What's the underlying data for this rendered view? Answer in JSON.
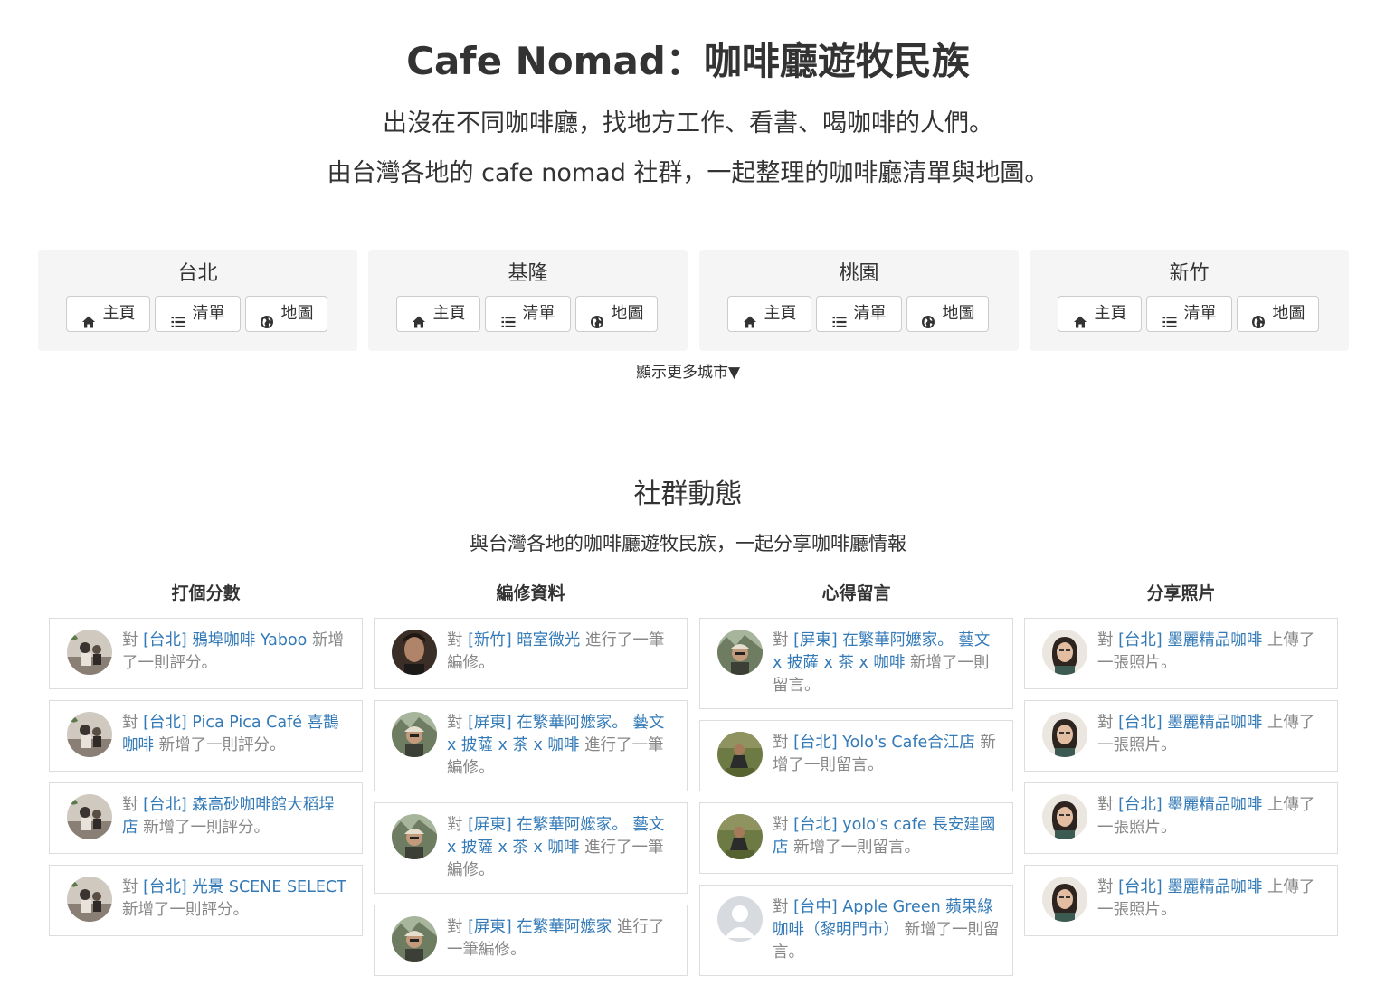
{
  "header": {
    "title": "Cafe Nomad：咖啡廳遊牧民族",
    "subtitle_line1": "出沒在不同咖啡廳，找地方工作、看書、喝咖啡的人們。",
    "subtitle_line2": "由台灣各地的 cafe nomad 社群，一起整理的咖啡廳清單與地圖。"
  },
  "cities": [
    {
      "name": "台北",
      "buttons": [
        "主頁",
        "清單",
        "地圖"
      ]
    },
    {
      "name": "基隆",
      "buttons": [
        "主頁",
        "清單",
        "地圖"
      ]
    },
    {
      "name": "桃園",
      "buttons": [
        "主頁",
        "清單",
        "地圖"
      ]
    },
    {
      "name": "新竹",
      "buttons": [
        "主頁",
        "清單",
        "地圖"
      ]
    }
  ],
  "button_icons": [
    "home-icon",
    "list-icon",
    "globe-icon"
  ],
  "more_cities_label": "顯示更多城市▼",
  "community": {
    "title": "社群動態",
    "subtitle": "與台灣各地的咖啡廳遊牧民族，一起分享咖啡廳情報",
    "columns": [
      {
        "heading": "打個分數",
        "items": [
          {
            "prefix": "對 ",
            "link": "[台北] 鴉埠咖啡 Yaboo",
            "suffix": " 新增了一則評分。",
            "avatar": "avatar-photo-a"
          },
          {
            "prefix": "對 ",
            "link": "[台北] Pica Pica Café 喜鵲咖啡",
            "suffix": " 新增了一則評分。",
            "avatar": "avatar-photo-a"
          },
          {
            "prefix": "對 ",
            "link": "[台北] 森高砂咖啡館大稻埕店",
            "suffix": " 新增了一則評分。",
            "avatar": "avatar-photo-a"
          },
          {
            "prefix": "對 ",
            "link": "[台北] 光景 SCENE SELECT",
            "suffix": " 新增了一則評分。",
            "avatar": "avatar-photo-a"
          }
        ]
      },
      {
        "heading": "編修資料",
        "items": [
          {
            "prefix": "對 ",
            "link": "[新竹] 暗室微光",
            "suffix": " 進行了一筆編修。",
            "avatar": "avatar-photo-b"
          },
          {
            "prefix": "對 ",
            "link": "[屏東] 在繁華阿嬤家。 藝文 x 披薩 x 茶 x 咖啡",
            "suffix": " 進行了一筆編修。",
            "avatar": "avatar-photo-c"
          },
          {
            "prefix": "對 ",
            "link": "[屏東] 在繁華阿嬤家。 藝文 x 披薩 x 茶 x 咖啡",
            "suffix": " 進行了一筆編修。",
            "avatar": "avatar-photo-c"
          },
          {
            "prefix": "對 ",
            "link": "[屏東] 在繁華阿嬤家",
            "suffix": " 進行了一筆編修。",
            "avatar": "avatar-photo-c"
          }
        ]
      },
      {
        "heading": "心得留言",
        "items": [
          {
            "prefix": "對 ",
            "link": "[屏東] 在繁華阿嬤家。 藝文 x 披薩 x 茶 x 咖啡",
            "suffix": " 新增了一則留言。",
            "avatar": "avatar-photo-c"
          },
          {
            "prefix": "對 ",
            "link": "[台北] Yolo's Cafe合江店",
            "suffix": " 新增了一則留言。",
            "avatar": "avatar-photo-d"
          },
          {
            "prefix": "對 ",
            "link": "[台北] yolo's cafe 長安建國店",
            "suffix": " 新增了一則留言。",
            "avatar": "avatar-photo-d"
          },
          {
            "prefix": "對 ",
            "link": "[台中] Apple Green 蘋果綠咖啡（黎明門市）",
            "suffix": " 新增了一則留言。",
            "avatar": "avatar-placeholder"
          }
        ]
      },
      {
        "heading": "分享照片",
        "items": [
          {
            "prefix": "對 ",
            "link": "[台北] 墨麗精品咖啡",
            "suffix": " 上傳了一張照片。",
            "avatar": "avatar-photo-e"
          },
          {
            "prefix": "對 ",
            "link": "[台北] 墨麗精品咖啡",
            "suffix": " 上傳了一張照片。",
            "avatar": "avatar-photo-e"
          },
          {
            "prefix": "對 ",
            "link": "[台北] 墨麗精品咖啡",
            "suffix": " 上傳了一張照片。",
            "avatar": "avatar-photo-e"
          },
          {
            "prefix": "對 ",
            "link": "[台北] 墨麗精品咖啡",
            "suffix": " 上傳了一張照片。",
            "avatar": "avatar-photo-e"
          }
        ]
      }
    ]
  },
  "colors": {
    "link": "#337ab7",
    "muted": "#888888",
    "card_bg": "#f5f5f5",
    "text": "#333333"
  }
}
